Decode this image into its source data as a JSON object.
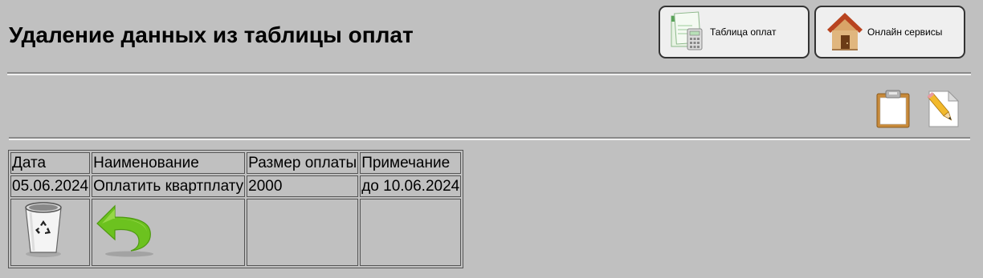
{
  "page": {
    "title": "Удаление данных из таблицы оплат"
  },
  "nav": {
    "payments_table_label": "Таблица оплат",
    "online_services_label": "Онлайн сервисы"
  },
  "toolbar": {
    "icons": [
      "clipboard-icon",
      "edit-document-icon"
    ]
  },
  "table": {
    "headers": [
      "Дата",
      "Наименование",
      "Размер оплаты",
      "Примечание"
    ],
    "rows": [
      [
        "05.06.2024",
        "Оплатить квартплату",
        "2000",
        "до 10.06.2024"
      ]
    ],
    "actions": [
      "trash-icon",
      "undo-arrow-icon"
    ]
  },
  "colors": {
    "background": "#c0c0c0",
    "button_background": "#efefef",
    "arrow_green": "#6cc21f"
  }
}
